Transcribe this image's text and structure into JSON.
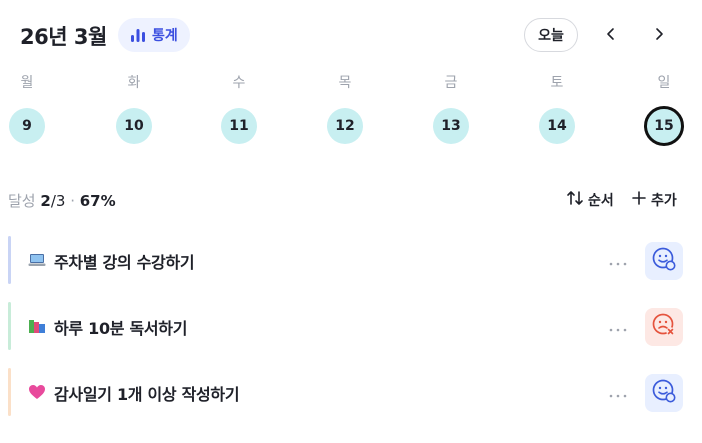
{
  "header": {
    "month_title": "26년 3월",
    "stats_label": "통계",
    "today_label": "오늘"
  },
  "week": [
    {
      "day": "월",
      "date": "9",
      "selected": false
    },
    {
      "day": "화",
      "date": "10",
      "selected": false
    },
    {
      "day": "수",
      "date": "11",
      "selected": false
    },
    {
      "day": "목",
      "date": "12",
      "selected": false
    },
    {
      "day": "금",
      "date": "13",
      "selected": false
    },
    {
      "day": "토",
      "date": "14",
      "selected": false
    },
    {
      "day": "일",
      "date": "15",
      "selected": true
    }
  ],
  "summary": {
    "label": "달성",
    "done": "2",
    "total": "/3",
    "sep": " · ",
    "percent": "67%"
  },
  "toolbar": {
    "order_label": "순서",
    "add_label": "추가"
  },
  "habits": [
    {
      "title": "주차별 강의 수강하기",
      "emoji": "laptop-icon",
      "bar_color": "#c9d4f5",
      "status": "done"
    },
    {
      "title": "하루 10분 독서하기",
      "emoji": "books-icon",
      "bar_color": "#c8ecd9",
      "status": "fail"
    },
    {
      "title": "감사일기 1개 이상 작성하기",
      "emoji": "heart-icon",
      "bar_color": "#fbe0c8",
      "status": "done"
    }
  ],
  "colors": {
    "accent": "#3b4fe0",
    "date_bg": "#c8eff1",
    "done_bg": "#e8efff",
    "fail_bg": "#fde8e4",
    "fail_fg": "#e5533d",
    "done_fg": "#3b5bdb"
  }
}
